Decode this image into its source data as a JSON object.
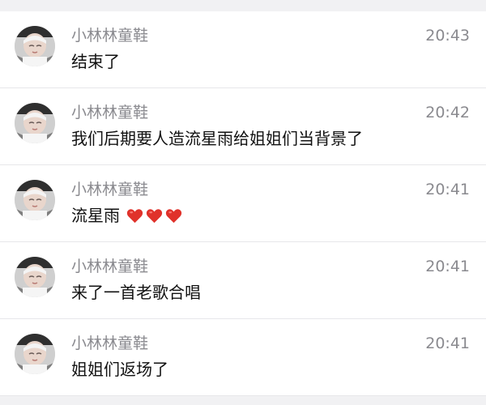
{
  "comments": [
    {
      "user": "小林林童鞋",
      "time": "20:43",
      "text": "结束了",
      "hearts": 0
    },
    {
      "user": "小林林童鞋",
      "time": "20:42",
      "text": "我们后期要人造流星雨给姐姐们当背景了",
      "hearts": 0
    },
    {
      "user": "小林林童鞋",
      "time": "20:41",
      "text": "流星雨",
      "hearts": 3
    },
    {
      "user": "小林林童鞋",
      "time": "20:41",
      "text": "来了一首老歌合唱",
      "hearts": 0
    },
    {
      "user": "小林林童鞋",
      "time": "20:41",
      "text": "姐姐们返场了",
      "hearts": 0
    }
  ],
  "colors": {
    "name": "#8a8a8f",
    "time": "#8a8a8f",
    "text": "#111111",
    "divider": "#e7e7ea",
    "heart": "#e0322b",
    "strip": "#f1f1f3"
  },
  "icons": {
    "avatar": "baby-photo-avatar",
    "heart": "red-heart-emoji"
  }
}
